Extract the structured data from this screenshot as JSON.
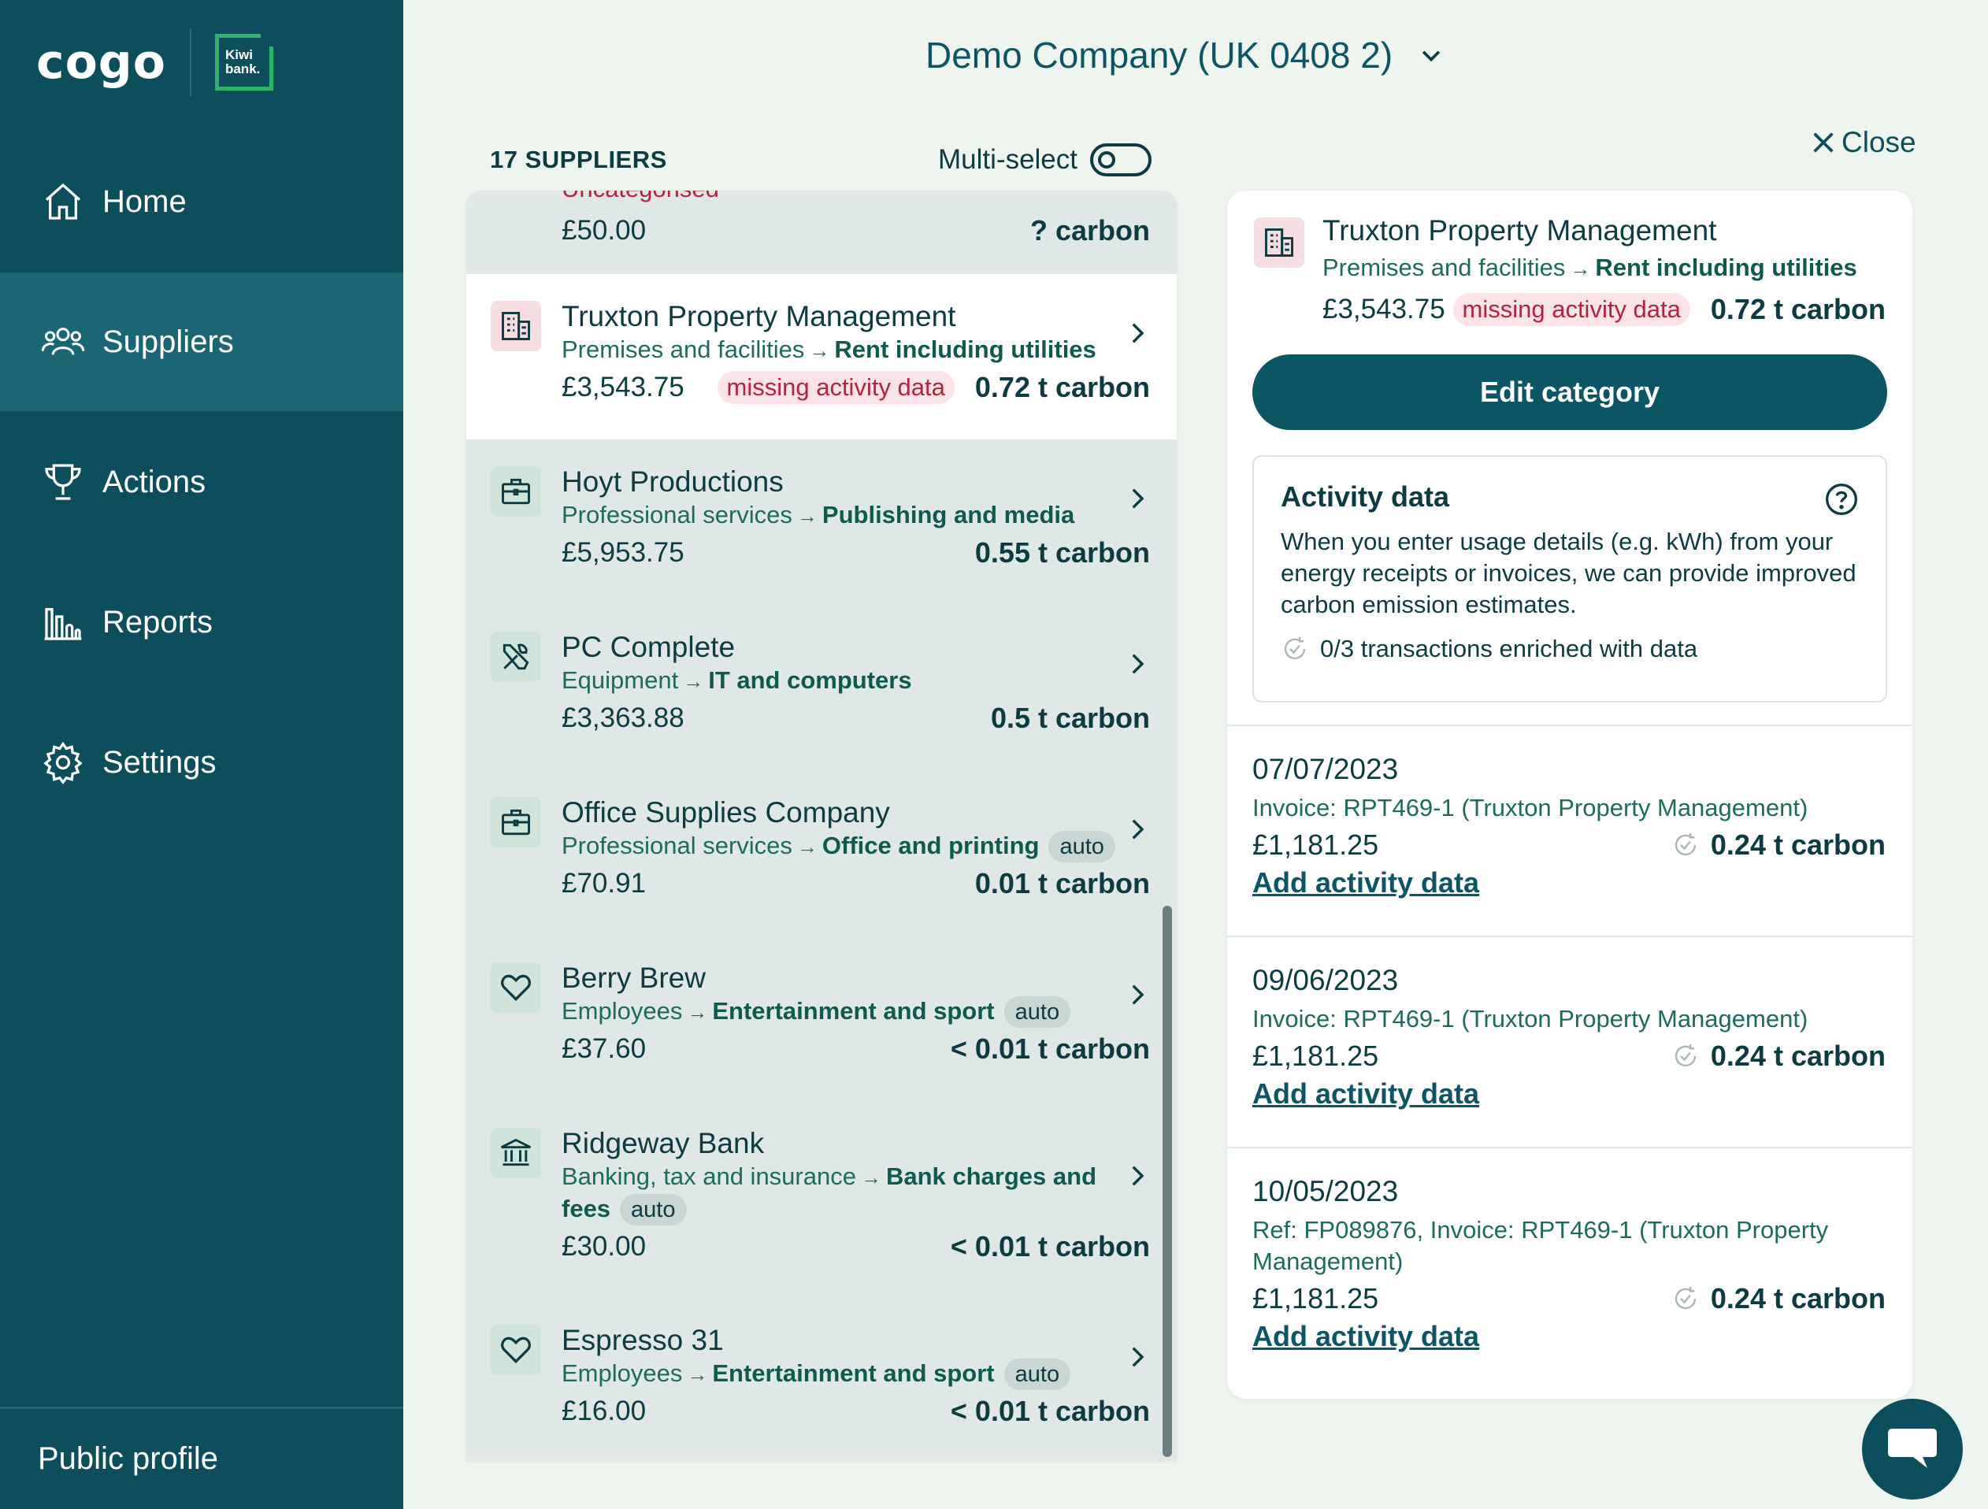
{
  "brand": {
    "logo": "cogo",
    "badge_line1": "Kiwi",
    "badge_line2": "bank."
  },
  "nav": {
    "home": "Home",
    "suppliers": "Suppliers",
    "actions": "Actions",
    "reports": "Reports",
    "settings": "Settings",
    "public_profile": "Public profile"
  },
  "header": {
    "company": "Demo Company (UK 0408 2)"
  },
  "list": {
    "count": "17 SUPPLIERS",
    "multiselect": "Multi-select",
    "partial": {
      "amount": "£50.00",
      "carbon": "? carbon",
      "cut_text": "Uncategorised"
    },
    "suppliers": [
      {
        "name": "Truxton Property Management",
        "cat": "Premises and facilities",
        "sub": "Rent including utilities",
        "amount": "£3,543.75",
        "missing": "missing activity data",
        "carbon": "0.72 t carbon"
      },
      {
        "name": "Hoyt Productions",
        "cat": "Professional services",
        "sub": "Publishing and media",
        "amount": "£5,953.75",
        "carbon": "0.55 t carbon"
      },
      {
        "name": "PC Complete",
        "cat": "Equipment",
        "sub": "IT and computers",
        "amount": "£3,363.88",
        "carbon": "0.5 t carbon"
      },
      {
        "name": "Office Supplies Company",
        "cat": "Professional services",
        "sub": "Office and printing",
        "auto": "auto",
        "amount": "£70.91",
        "carbon": "0.01 t carbon"
      },
      {
        "name": "Berry Brew",
        "cat": "Employees",
        "sub": "Entertainment and sport",
        "auto": "auto",
        "amount": "£37.60",
        "carbon": "< 0.01 t carbon"
      },
      {
        "name": "Ridgeway Bank",
        "cat": "Banking, tax and insurance",
        "sub": "Bank charges and",
        "sub2": "fees",
        "auto": "auto",
        "amount": "£30.00",
        "carbon": "< 0.01 t carbon"
      },
      {
        "name": "Espresso 31",
        "cat": "Employees",
        "sub": "Entertainment and sport",
        "auto": "auto",
        "amount": "£16.00",
        "carbon": "< 0.01 t carbon"
      }
    ]
  },
  "detail": {
    "close": "Close",
    "name": "Truxton Property Management",
    "cat": "Premises and facilities",
    "sub": "Rent including utilities",
    "amount": "£3,543.75",
    "missing": "missing activity data",
    "carbon": "0.72 t carbon",
    "edit": "Edit category",
    "activity_title": "Activity data",
    "activity_text": "When you enter usage details (e.g. kWh) from your energy receipts or invoices, we can provide improved carbon emission estimates.",
    "enriched": "0/3 transactions enriched with data",
    "transactions": [
      {
        "date": "07/07/2023",
        "invoice": "Invoice: RPT469-1 (Truxton Property Management)",
        "amount": "£1,181.25",
        "carbon": "0.24 t carbon",
        "link": "Add activity data"
      },
      {
        "date": "09/06/2023",
        "invoice": "Invoice: RPT469-1 (Truxton Property Management)",
        "amount": "£1,181.25",
        "carbon": "0.24 t carbon",
        "link": "Add activity data"
      },
      {
        "date": "10/05/2023",
        "invoice": "Ref: FP089876, Invoice: RPT469-1 (Truxton Property Management)",
        "amount": "£1,181.25",
        "carbon": "0.24 t carbon",
        "link": "Add activity data"
      }
    ]
  },
  "colors": {
    "sidebar": "#0c4e5c",
    "sidebar_active": "#1a6675",
    "background": "#eef5ee",
    "accent": "#0c5564",
    "missing": "#b0253d"
  }
}
